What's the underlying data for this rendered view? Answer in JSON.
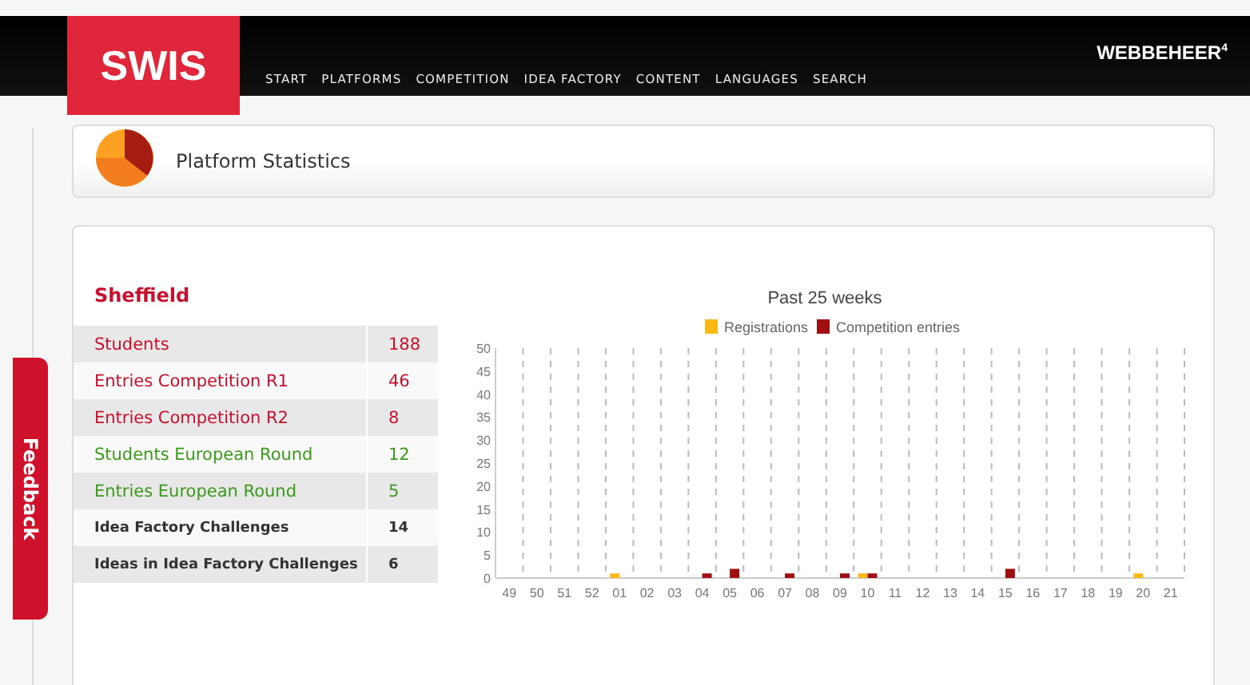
{
  "header": {
    "logo": "SWIS",
    "nav": [
      "START",
      "PLATFORMS",
      "COMPETITION",
      "IDEA FACTORY",
      "CONTENT",
      "LANGUAGES",
      "SEARCH"
    ],
    "brand": "WEBBEHEER",
    "brand_sup": "4"
  },
  "feedback": "Feedback",
  "title_panel": {
    "title": "Platform Statistics"
  },
  "stats": {
    "heading": "Sheffield",
    "rows": [
      {
        "label": "Students",
        "value": "188",
        "kind": "red"
      },
      {
        "label": "Entries Competition R1",
        "value": "46",
        "kind": "red"
      },
      {
        "label": "Entries Competition R2",
        "value": "8",
        "kind": "red"
      },
      {
        "label": "Students European Round",
        "value": "12",
        "kind": "green"
      },
      {
        "label": "Entries European Round",
        "value": "5",
        "kind": "green"
      },
      {
        "label": "Idea Factory Challenges",
        "value": "14",
        "kind": "dark"
      },
      {
        "label": "Ideas in Idea Factory Challenges",
        "value": "6",
        "kind": "dark"
      }
    ]
  },
  "chart_data": {
    "type": "bar",
    "title": "Past 25 weeks",
    "categories": [
      "49",
      "50",
      "51",
      "52",
      "01",
      "02",
      "03",
      "04",
      "05",
      "06",
      "07",
      "08",
      "09",
      "10",
      "11",
      "12",
      "13",
      "14",
      "15",
      "16",
      "17",
      "18",
      "19",
      "20",
      "21"
    ],
    "series": [
      {
        "name": "Registrations",
        "color": "#fbb917",
        "values": [
          0,
          0,
          0,
          0,
          1,
          0,
          0,
          0,
          0,
          0,
          0,
          0,
          0,
          1,
          0,
          0,
          0,
          0,
          0,
          0,
          0,
          0,
          0,
          1,
          0
        ]
      },
      {
        "name": "Competition entries",
        "color": "#a01010",
        "values": [
          0,
          0,
          0,
          0,
          0,
          0,
          0,
          1,
          2,
          0,
          1,
          0,
          1,
          1,
          0,
          0,
          0,
          0,
          2,
          0,
          0,
          0,
          0,
          0,
          0
        ]
      }
    ],
    "legend": true,
    "ylim": [
      0,
      50
    ],
    "yticks": [
      0,
      5,
      10,
      15,
      20,
      25,
      30,
      35,
      40,
      45,
      50
    ]
  }
}
